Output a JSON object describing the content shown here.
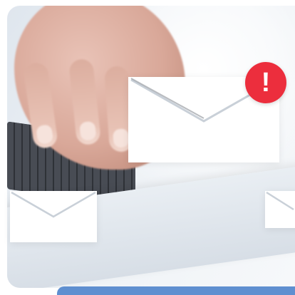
{
  "image": {
    "alert_symbol": "!",
    "accent_color": "#ec2e3d",
    "bar_color": "#5f8fd0",
    "icons": [
      "envelope-icon",
      "alert-icon"
    ]
  }
}
